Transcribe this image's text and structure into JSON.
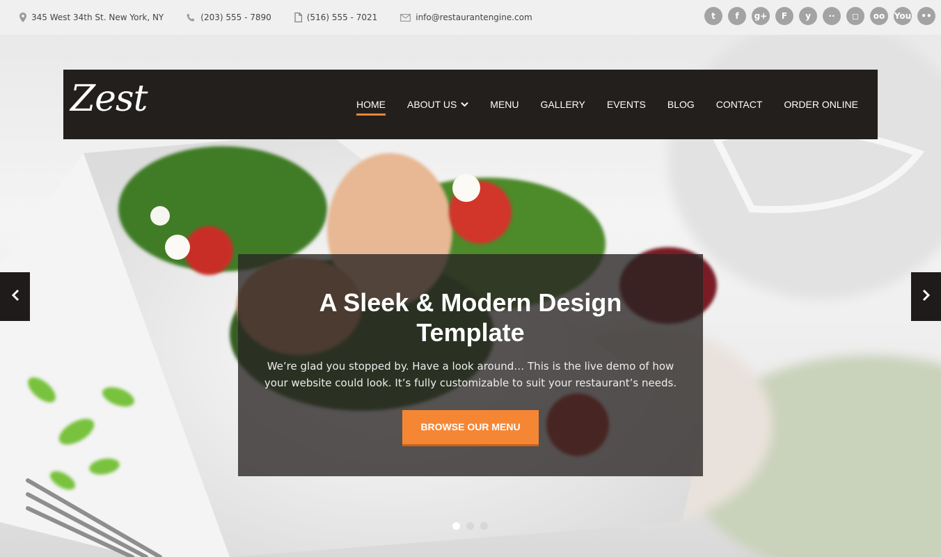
{
  "contact": {
    "address": "345 West 34th St. New York, NY",
    "phone": "(203) 555 - 7890",
    "fax": "(516) 555 - 7021",
    "email": "info@restaurantengine.com"
  },
  "social": [
    {
      "name": "twitter",
      "glyph": "t"
    },
    {
      "name": "facebook",
      "glyph": "f"
    },
    {
      "name": "google-plus",
      "glyph": "g+"
    },
    {
      "name": "foursquare",
      "glyph": "F"
    },
    {
      "name": "yelp",
      "glyph": "y"
    },
    {
      "name": "flickr-dots",
      "glyph": "··"
    },
    {
      "name": "instagram",
      "glyph": "◻"
    },
    {
      "name": "tripadvisor",
      "glyph": "oo"
    },
    {
      "name": "youtube",
      "glyph": "You"
    },
    {
      "name": "flickr",
      "glyph": "••"
    }
  ],
  "header": {
    "logo": "Zest",
    "nav": [
      {
        "label": "HOME",
        "active": true
      },
      {
        "label": "ABOUT US",
        "dropdown": true
      },
      {
        "label": "MENU"
      },
      {
        "label": "GALLERY"
      },
      {
        "label": "EVENTS"
      },
      {
        "label": "BLOG"
      },
      {
        "label": "CONTACT"
      },
      {
        "label": "ORDER ONLINE"
      }
    ]
  },
  "slide": {
    "title": "A Sleek & Modern Design Template",
    "text": "We’re glad you stopped by.  Have a look around…  This is the live demo of how your website could look.  It’s fully customizable to suit your restaurant’s needs.",
    "button": "BROWSE OUR MENU"
  },
  "slider": {
    "dots": 3,
    "active_dot": 1
  },
  "colors": {
    "accent": "#f58634",
    "header_bg": "#231f1d",
    "social_icon": "#a3a3a3"
  }
}
